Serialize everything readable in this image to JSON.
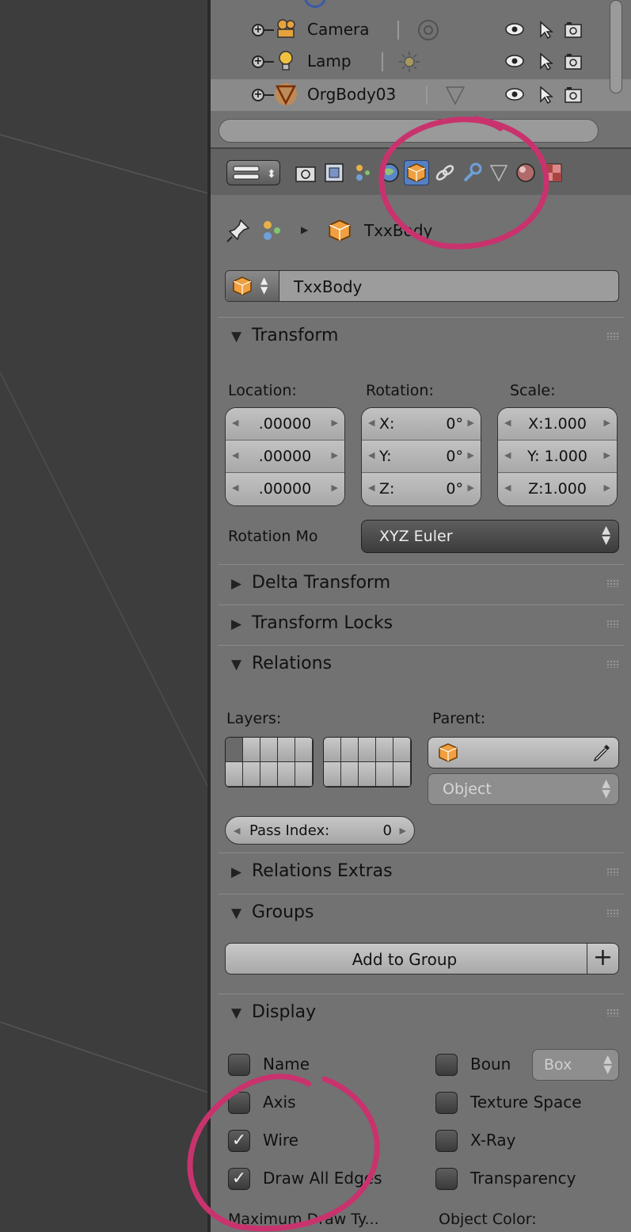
{
  "outliner": {
    "items": [
      {
        "label": "Camera",
        "selected": false
      },
      {
        "label": "Lamp",
        "selected": false
      },
      {
        "label": "OrgBody03",
        "selected": true
      }
    ]
  },
  "properties": {
    "breadcrumb": "TxxBody",
    "object_name": "TxxBody",
    "transform": {
      "title": "Transform",
      "location_label": "Location:",
      "rotation_label": "Rotation:",
      "scale_label": "Scale:",
      "location": [
        ".00000",
        ".00000",
        ".00000"
      ],
      "rotation": [
        {
          "axis": "X:",
          "value": "0°"
        },
        {
          "axis": "Y:",
          "value": "0°"
        },
        {
          "axis": "Z:",
          "value": "0°"
        }
      ],
      "scale": [
        "X:1.000",
        "Y: 1.000",
        "Z:1.000"
      ],
      "rotation_mode_label": "Rotation Mo",
      "rotation_mode_value": "XYZ Euler"
    },
    "delta_transform": {
      "title": "Delta Transform"
    },
    "transform_locks": {
      "title": "Transform Locks"
    },
    "relations": {
      "title": "Relations",
      "layers_label": "Layers:",
      "parent_label": "Parent:",
      "parent_type": "Object",
      "pass_index_label": "Pass Index:",
      "pass_index_value": "0"
    },
    "relations_extras": {
      "title": "Relations Extras"
    },
    "groups": {
      "title": "Groups",
      "add_label": "Add to Group"
    },
    "display": {
      "title": "Display",
      "left": [
        {
          "label": "Name",
          "checked": false
        },
        {
          "label": "Axis",
          "checked": false
        },
        {
          "label": "Wire",
          "checked": true
        },
        {
          "label": "Draw All Edges",
          "checked": true
        }
      ],
      "right": [
        {
          "label": "Boun",
          "checked": false
        },
        {
          "label": "Texture Space",
          "checked": false
        },
        {
          "label": "X-Ray",
          "checked": false
        },
        {
          "label": "Transparency",
          "checked": false
        }
      ],
      "bounds_type": "Box",
      "max_draw_type_label": "Maximum Draw Ty...",
      "object_color_label": "Object Color:"
    }
  },
  "colors": {
    "annotation": "#c8336e",
    "active_tab": "#5680c2",
    "object_orange": "#f0a040"
  },
  "icons": {
    "checkbox_checked": "✓",
    "triangle_open": "▼",
    "triangle_closed": "▶",
    "updown": "▲▼",
    "plus": "+",
    "eyedropper": "eyedropper-icon"
  }
}
